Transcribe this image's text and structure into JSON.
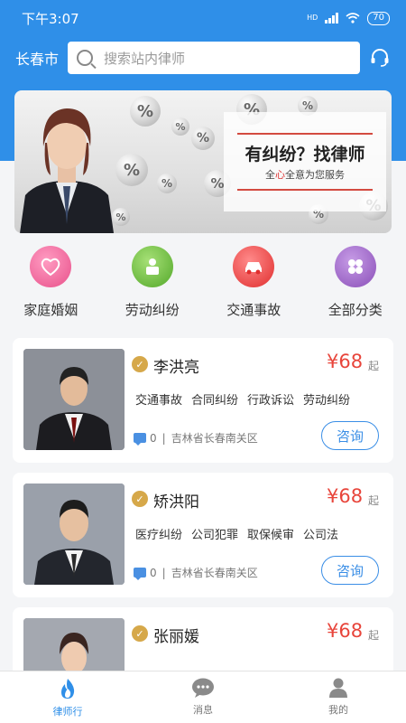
{
  "status": {
    "time": "下午3:07",
    "battery": "70",
    "network": "HD"
  },
  "header": {
    "city": "长春市",
    "search_placeholder": "搜索站内律师",
    "headset_icon": "headset-icon"
  },
  "banner": {
    "title": "有纠纷？找律师",
    "subtitle_pre": "全",
    "subtitle_heart": "心",
    "subtitle_post": "全意为您服务",
    "bubble_symbol": "%"
  },
  "categories": [
    {
      "label": "家庭婚姻",
      "icon": "heart-icon",
      "color": "#f06a9c"
    },
    {
      "label": "劳动纠纷",
      "icon": "worker-icon",
      "color": "#6bbf3e"
    },
    {
      "label": "交通事故",
      "icon": "car-icon",
      "color": "#ef3f3f"
    },
    {
      "label": "全部分类",
      "icon": "grid-icon",
      "color": "#9a65c4"
    }
  ],
  "lawyers": [
    {
      "name": "李洪亮",
      "price": "¥68",
      "unit": "起",
      "tags": [
        "交通事故",
        "合同纠纷",
        "行政诉讼",
        "劳动纠纷"
      ],
      "count": "0",
      "location": "吉林省长春南关区",
      "consult": "咨询"
    },
    {
      "name": "矫洪阳",
      "price": "¥68",
      "unit": "起",
      "tags": [
        "医疗纠纷",
        "公司犯罪",
        "取保候审",
        "公司法"
      ],
      "count": "0",
      "location": "吉林省长春南关区",
      "consult": "咨询"
    },
    {
      "name": "张丽媛",
      "price": "¥68",
      "unit": "起",
      "tags": [],
      "count": "",
      "location": "",
      "consult": ""
    }
  ],
  "meta_separator": "|",
  "tabbar": [
    {
      "label": "律师行",
      "icon": "flame-icon",
      "active": true
    },
    {
      "label": "消息",
      "icon": "chat-icon",
      "active": false
    },
    {
      "label": "我的",
      "icon": "person-icon",
      "active": false
    }
  ],
  "colors": {
    "primary": "#2f8fe8",
    "price": "#e8453b",
    "badge": "#d6a84a"
  }
}
